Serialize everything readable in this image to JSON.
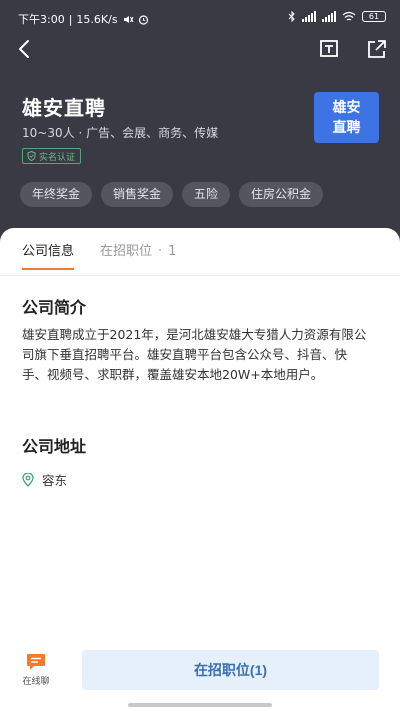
{
  "status_bar": {
    "time": "下午3:00",
    "network_speed": "15.6K/s",
    "battery_level": "61",
    "icons": [
      "mute-icon",
      "alarm-icon",
      "bluetooth-icon",
      "signal-icon",
      "signal-icon",
      "wifi-icon",
      "battery-icon"
    ]
  },
  "company": {
    "name": "雄安直聘",
    "size": "10~30人",
    "industries": "广告、会展、商务、传媒",
    "verified_label": "实名认证",
    "logo_text_line1": "雄安",
    "logo_text_line2": "直聘"
  },
  "benefits": [
    "年终奖金",
    "销售奖金",
    "五险",
    "住房公积金"
  ],
  "tabs": {
    "company_info": "公司信息",
    "open_positions": "在招职位",
    "open_positions_count": "1"
  },
  "intro": {
    "title": "公司简介",
    "body": "雄安直聘成立于2021年，是河北雄安雄大专猎人力资源有限公司旗下垂直招聘平台。雄安直聘平台包含公众号、抖音、快手、视频号、求职群，覆盖雄安本地20W+本地用户。"
  },
  "address": {
    "title": "公司地址",
    "value": "容东"
  },
  "bottom": {
    "chat_label": "在线聊",
    "jobs_button": "在招职位(1)"
  },
  "colors": {
    "header_bg": "#3a3a45",
    "logo_bg": "#3e73e6",
    "accent_orange": "#f37b2a",
    "verified_green": "#5aa27a",
    "jobs_button_bg": "#e6f0fb",
    "jobs_button_text": "#3a6fb0"
  }
}
